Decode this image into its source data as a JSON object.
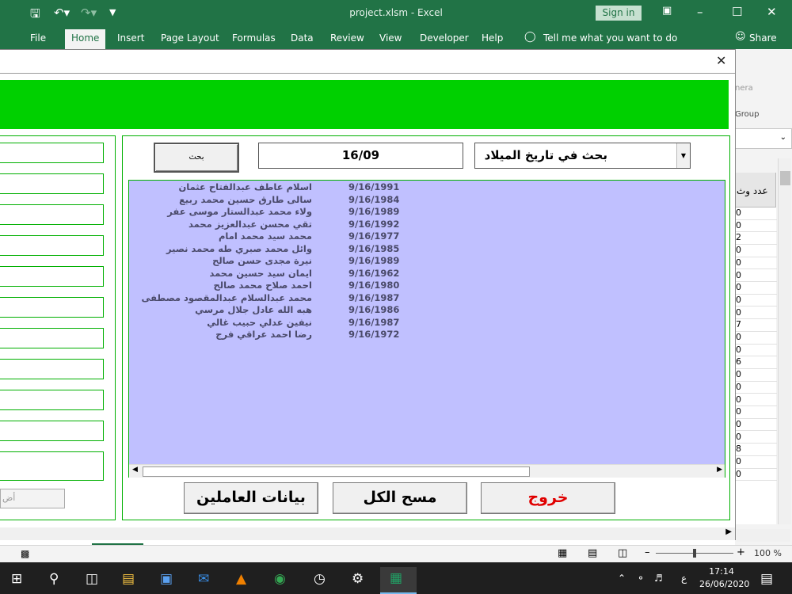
{
  "excel": {
    "file_name": "project.xlsm  -  Excel",
    "sign_in": "Sign in",
    "tabs": [
      "File",
      "Home",
      "Insert",
      "Page Layout",
      "Formulas",
      "Data",
      "Review",
      "View",
      "Developer",
      "Help"
    ],
    "tell_me": "Tell me what you want to do",
    "share": "Share",
    "ribbon_right_text": "nera",
    "group_label": "Group",
    "column_header": "عدد وث",
    "cell_values": [
      "0",
      "0",
      "2",
      "0",
      "0",
      "0",
      "0",
      "0",
      "0",
      "7",
      "0",
      "0",
      "6",
      "0",
      "0",
      "0",
      "0",
      "0",
      "0",
      "8",
      "0",
      "0"
    ],
    "zoom": "100 %"
  },
  "form": {
    "search_button": "بحث",
    "search_value": "16/09",
    "criteria": "بحث في تاريخ الميلاد",
    "left_button": "أض",
    "results": [
      {
        "name": "اسلام عاطف عبدالفتاح عثمان",
        "date": "9/16/1991"
      },
      {
        "name": "سالى طارق حسين محمد ربيع",
        "date": "9/16/1984"
      },
      {
        "name": "ولاء محمد عبدالستار موسى عفر",
        "date": "9/16/1989"
      },
      {
        "name": "تقي محسن عبدالعزيز محمد",
        "date": "9/16/1992"
      },
      {
        "name": "محمد سيد محمد امام",
        "date": "9/16/1977"
      },
      {
        "name": "وائل محمد صبري طه محمد نصير",
        "date": "9/16/1985"
      },
      {
        "name": "نيرة مجدى حسن صالح",
        "date": "9/16/1989"
      },
      {
        "name": "ايمان سيد حسين محمد",
        "date": "9/16/1962"
      },
      {
        "name": "احمد صلاح محمد صالح",
        "date": "9/16/1980"
      },
      {
        "name": "محمد عبدالسلام عبدالمقصود مصطفى",
        "date": "9/16/1987"
      },
      {
        "name": "هبه الله عادل جلال مرسي",
        "date": "9/16/1986"
      },
      {
        "name": "نيفين عدلي حبيب غالي",
        "date": "9/16/1987"
      },
      {
        "name": "رضا احمد عراقي فرج",
        "date": "9/16/1972"
      }
    ],
    "buttons": {
      "exit": "خروج",
      "clear": "مسح الكل",
      "workers": "بيانات العاملين"
    }
  },
  "taskbar": {
    "time": "17:14",
    "date": "26/06/2020",
    "lang": "ع"
  },
  "colors": {
    "excel_green": "#217346",
    "banner_green": "#00d000",
    "list_bg": "#c0c0ff",
    "exit_red": "#e00000"
  }
}
